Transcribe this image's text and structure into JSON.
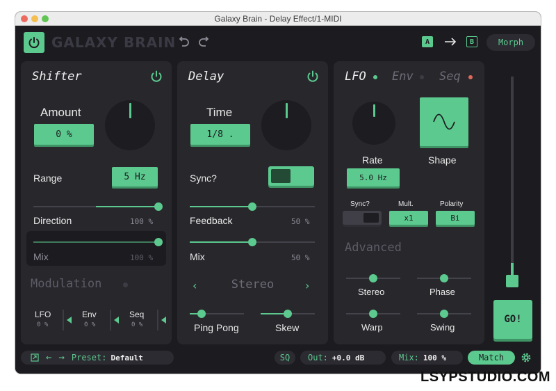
{
  "window": {
    "title": "Galaxy Brain - Delay Effect/1-MIDI"
  },
  "header": {
    "brand": "GALAXY BRAIN",
    "ab_a": "A",
    "ab_b": "B",
    "morph": "Morph"
  },
  "shifter": {
    "title": "Shifter",
    "amount_label": "Amount",
    "amount_value": "0 %",
    "range_label": "Range",
    "range_value": "5 Hz",
    "direction_label": "Direction",
    "direction_value": "100 %",
    "direction_level": 1.0,
    "mix_label": "Mix",
    "mix_value": "100 %",
    "mix_level": 1.0,
    "modulation_label": "Modulation",
    "mods": [
      {
        "label": "LFO",
        "value": "0 %"
      },
      {
        "label": "Env",
        "value": "0 %"
      },
      {
        "label": "Seq",
        "value": "0 %"
      }
    ]
  },
  "delay": {
    "title": "Delay",
    "time_label": "Time",
    "time_value": "1/8 .",
    "sync_label": "Sync?",
    "sync_on": true,
    "feedback_label": "Feedback",
    "feedback_value": "50 %",
    "feedback_level": 0.5,
    "mix_label": "Mix",
    "mix_value": "50 %",
    "mix_level": 0.5,
    "stereo_mode": "Stereo",
    "pingpong_label": "Ping Pong",
    "pingpong_level": 0.22,
    "skew_label": "Skew",
    "skew_level": 0.5
  },
  "mod_panel": {
    "tabs": [
      {
        "label": "LFO",
        "active": true,
        "dot_color": "#5cc98f"
      },
      {
        "label": "Env",
        "active": false,
        "dot_color": "#3d3c44"
      },
      {
        "label": "Seq",
        "active": false,
        "dot_color": "#e06a5a"
      }
    ],
    "rate_label": "Rate",
    "rate_value": "5.0 Hz",
    "shape_label": "Shape",
    "shape_icon": "sine-wave-icon",
    "sync_label": "Sync?",
    "sync_on": false,
    "mult_label": "Mult.",
    "mult_value": "x1",
    "polarity_label": "Polarity",
    "polarity_value": "Bi",
    "advanced_label": "Advanced",
    "advanced": [
      {
        "label": "Stereo",
        "level": 0.5
      },
      {
        "label": "Phase",
        "level": 0.5
      },
      {
        "label": "Warp",
        "level": 0.5
      },
      {
        "label": "Swing",
        "level": 0.5
      }
    ]
  },
  "master": {
    "output_level": 0.1,
    "go_label": "GO!"
  },
  "footer": {
    "preset_label": "Preset:",
    "preset_value": "Default",
    "sq": "SQ",
    "out_label": "Out:",
    "out_value": "+0.0 dB",
    "mix_label": "Mix:",
    "mix_value": "100 %",
    "match": "Match"
  },
  "watermark": "LSYPSTUDIO.COM",
  "colors": {
    "accent": "#5cc98f",
    "panel": "#28272c",
    "background": "#1c1b1f"
  }
}
